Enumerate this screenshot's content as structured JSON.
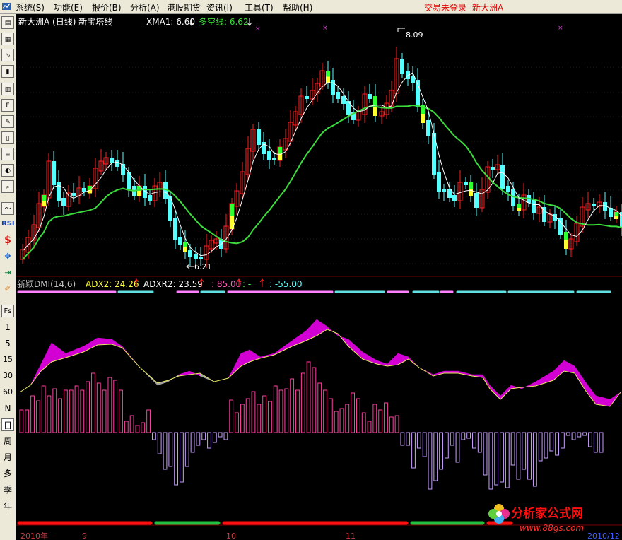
{
  "menu": {
    "items": [
      "系统(S)",
      "功能(E)",
      "报价(B)",
      "分析(A)",
      "港股期货",
      "资讯(I)",
      "工具(T)",
      "帮助(H)"
    ],
    "status_login": "交易未登录",
    "status_symbol": "新大洲A"
  },
  "toolbar": {
    "buttons": [
      "report-icon",
      "table-icon",
      "line-chart-icon",
      "candle-chart-icon",
      "news-icon",
      "finance-icon",
      "notes-icon",
      "file-icon",
      "list-icon",
      "sector-icon",
      "search-icon",
      "indicator-icon",
      "rsi",
      "money-icon",
      "move-icon",
      "exit-icon",
      "draw-icon",
      "fs"
    ],
    "rsi_label": "RSI",
    "fs_label": "Fs",
    "periods": [
      "1",
      "5",
      "15",
      "30",
      "60",
      "N",
      "日",
      "周",
      "月",
      "多",
      "季",
      "年"
    ]
  },
  "main_panel": {
    "title": "新大洲A (日线) 新宝塔线",
    "xma1": "XMA1: 6.60",
    "duokong": "多空线: 6.62",
    "high_label": "8.09",
    "low_label": "6.21"
  },
  "sub_panel": {
    "title": "新颖DMI(14,6)",
    "adx2": "ADX2: 24.26",
    "adxr2": "ADXR2: 23.59",
    "level_high": ": 85.00",
    "level_mid": ": -",
    "level_low": ": -55.00"
  },
  "x_axis": {
    "labels": [
      "2010年",
      "9",
      "10",
      "11",
      "2010/12"
    ]
  },
  "watermark": {
    "brand": "分析家公式网",
    "url": "www.88gs.com"
  },
  "colors": {
    "up": "#ff2020",
    "down": "#54ffff",
    "xma": "#ffffff",
    "duokong": "#3cdc3c",
    "bull_area": "#d200d2",
    "bear_area": "#a0a0a0",
    "hist_pos": "#ff40a0",
    "hist_neg": "#c8a0ff",
    "seg_up": "#ff1010",
    "seg_down": "#20c040"
  }
}
